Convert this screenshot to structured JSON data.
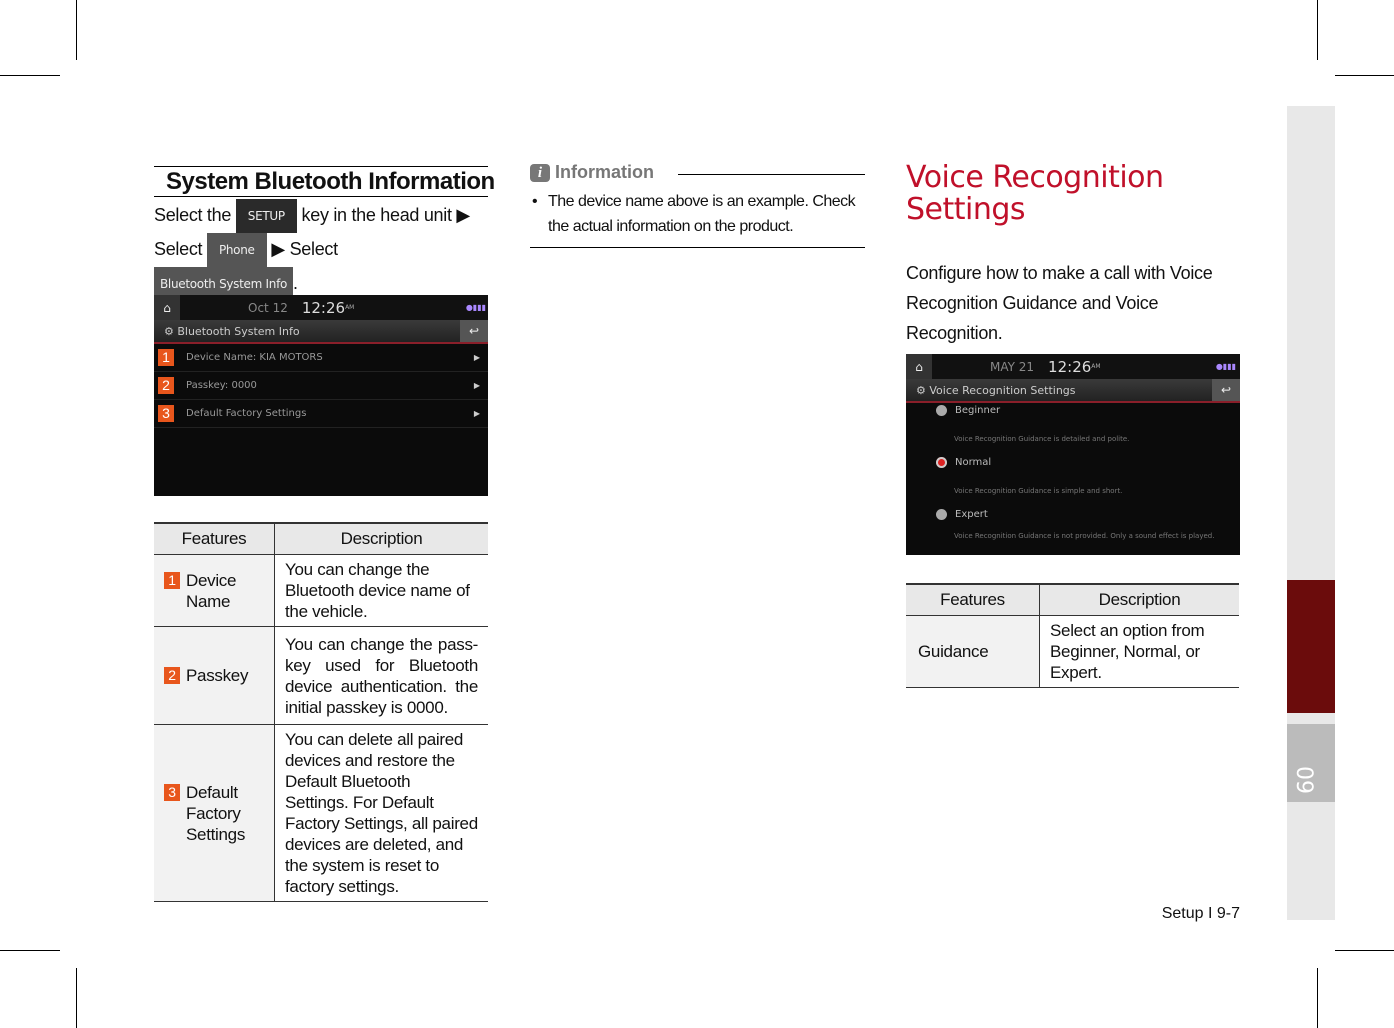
{
  "left": {
    "heading": "System Bluetooth Information",
    "instr": {
      "t1": "Select the",
      "key1": "SETUP",
      "t2": "key in the head unit ▶",
      "t3": "Select",
      "key2": "Phone",
      "t4": "▶ Select",
      "key3": "Bluetooth System Info",
      "t5": "."
    },
    "screen": {
      "date": "Oct 12",
      "time": "12:26",
      "ampm": "AM",
      "title": "Bluetooth System Info",
      "rows": [
        {
          "n": "1",
          "label": "Device Name: KIA MOTORS"
        },
        {
          "n": "2",
          "label": "Passkey: 0000"
        },
        {
          "n": "3",
          "label": "Default Factory Settings"
        }
      ]
    },
    "table": {
      "headers": [
        "Features",
        "Description"
      ],
      "rows": [
        {
          "n": "1",
          "feature": "Device Name",
          "desc": "You can change the Bluetooth device name of the vehicle."
        },
        {
          "n": "2",
          "feature": "Passkey",
          "desc": "You can change the pass-key used for Bluetooth device authentication. the initial passkey is 0000."
        },
        {
          "n": "3",
          "feature": "Default Factory Settings",
          "desc": "You can delete all paired devices and restore the Default Bluetooth Settings. For Default Factory Settings, all paired devices are deleted, and the system is reset to factory settings."
        }
      ]
    }
  },
  "info": {
    "heading": "Information",
    "bullet": "The device name above is an example. Check the actual information on the product."
  },
  "right": {
    "heading": "Voice Recognition Settings",
    "intro": "Configure how to make a call with Voice Recognition Guidance and Voice Recognition.",
    "screen": {
      "date": "MAY 21",
      "time": "12:26",
      "ampm": "AM",
      "title": "Voice Recognition Settings",
      "options": [
        {
          "label": "Beginner",
          "desc": "Voice Recognition Guidance is detailed and polite.",
          "selected": false
        },
        {
          "label": "Normal",
          "desc": "Voice Recognition Guidance is simple and short.",
          "selected": true
        },
        {
          "label": "Expert",
          "desc": "Voice Recognition Guidance is not provided. Only a sound effect is played.",
          "selected": false
        }
      ]
    },
    "table": {
      "headers": [
        "Features",
        "Description"
      ],
      "rows": [
        {
          "feature": "Guidance",
          "desc": "Select an option from Beginner, Normal, or Expert."
        }
      ]
    }
  },
  "chapter_tab": "09",
  "footer": "Setup I 9-7",
  "colors": {
    "accent": "#c0102a",
    "tab_red": "#6b0c0c",
    "number_badge": "#e8561c"
  }
}
